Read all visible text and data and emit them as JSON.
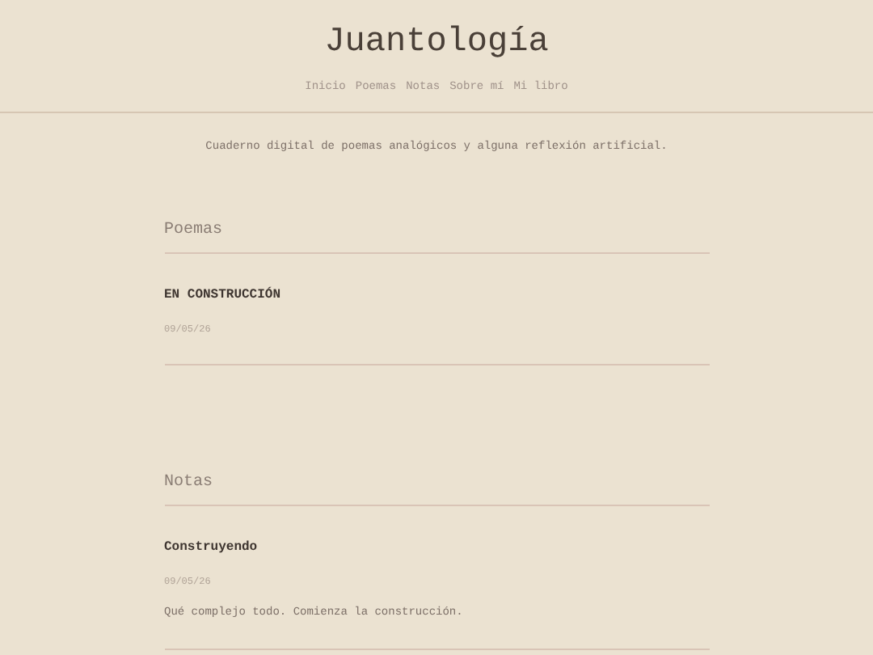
{
  "site": {
    "title": "Juantología",
    "nav": [
      "Inicio",
      "Poemas",
      "Notas",
      "Sobre mí",
      "Mi libro"
    ],
    "tagline": "Cuaderno digital de poemas analógicos y alguna reflexión artificial."
  },
  "sections": [
    {
      "heading": "Poemas",
      "entries": [
        {
          "title": "EN CONSTRUCCIÓN",
          "date": "09/05/26"
        }
      ]
    },
    {
      "heading": "Notas",
      "entries": [
        {
          "title": "Construyendo",
          "date": "09/05/26",
          "excerpt": "Qué complejo todo. Comienza la construcción."
        }
      ]
    }
  ]
}
